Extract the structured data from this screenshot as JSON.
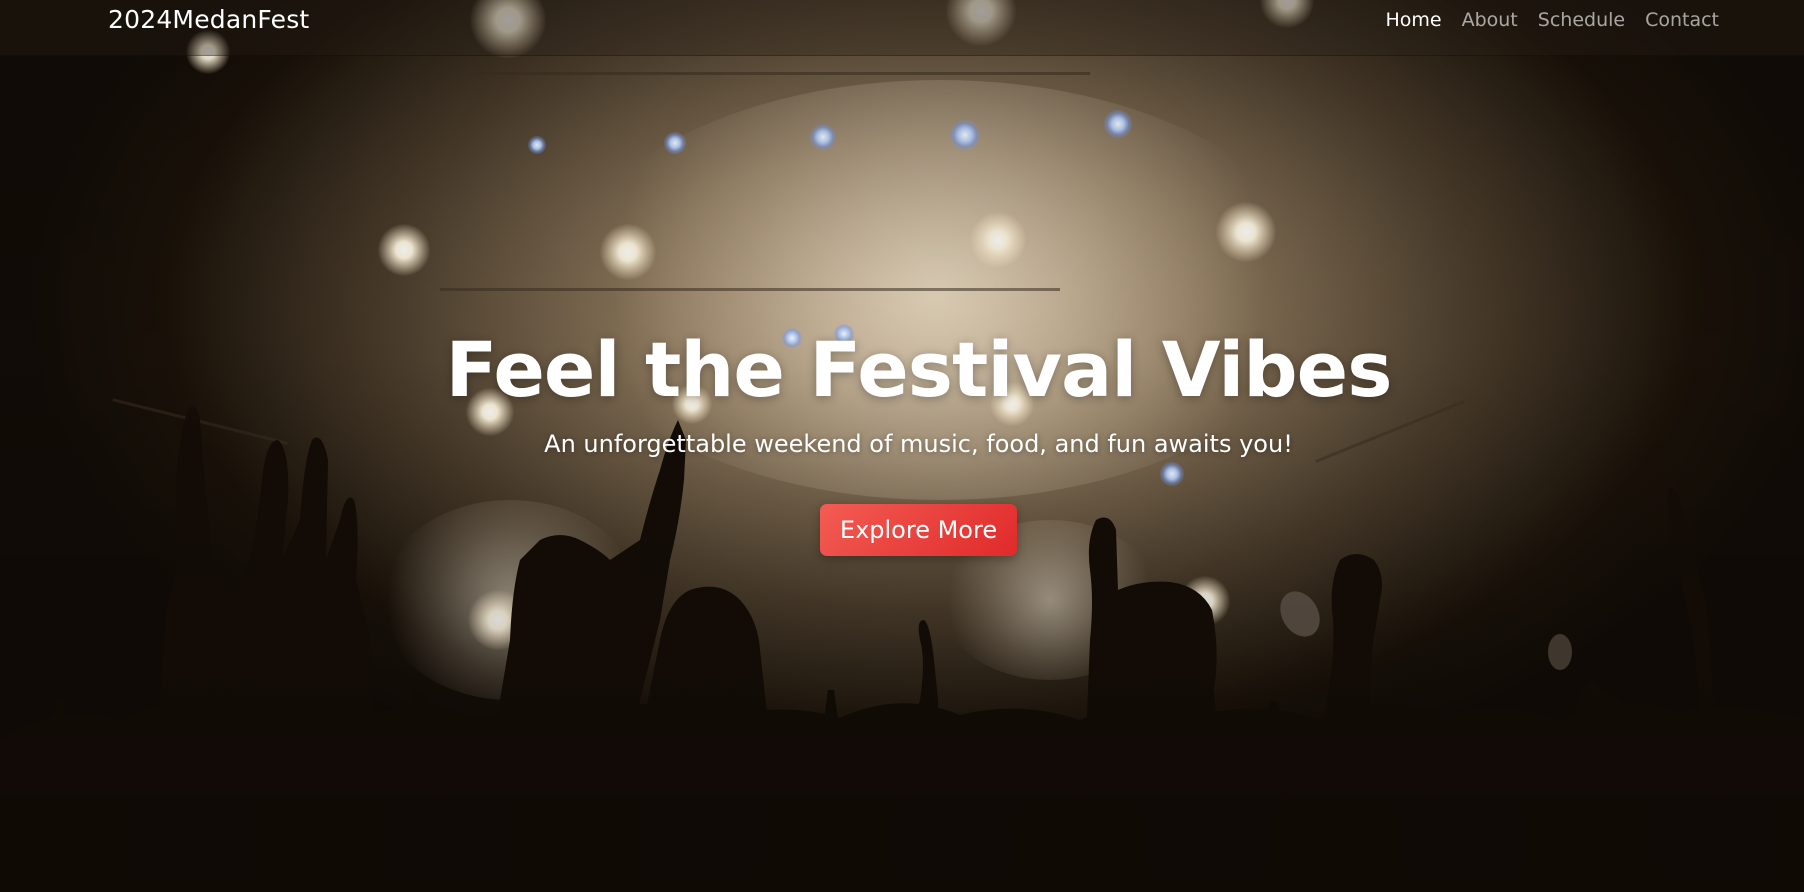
{
  "navbar": {
    "brand": "2024MedanFest",
    "links": [
      {
        "label": "Home",
        "active": true
      },
      {
        "label": "About",
        "active": false
      },
      {
        "label": "Schedule",
        "active": false
      },
      {
        "label": "Contact",
        "active": false
      }
    ]
  },
  "hero": {
    "headline": "Feel the Festival Vibes",
    "subtitle": "An unforgettable weekend of music, food, and fun awaits you!",
    "cta_label": "Explore More",
    "background_image": "concert-crowd-stage-lights"
  },
  "colors": {
    "cta_gradient_start": "#f35c54",
    "cta_gradient_end": "#e02a2a",
    "nav_active": "#ffffff",
    "nav_inactive": "#b9b2a8"
  }
}
